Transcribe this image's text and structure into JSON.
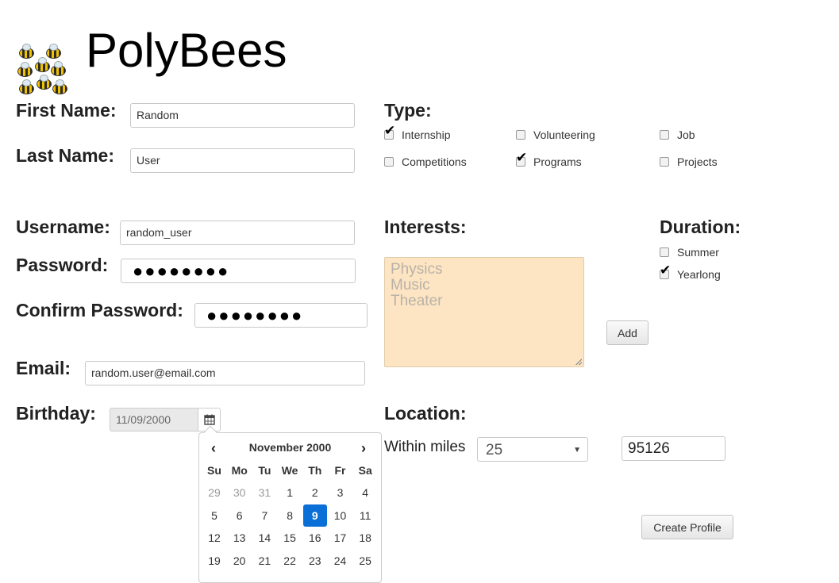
{
  "app": {
    "title": "PolyBees"
  },
  "form": {
    "first_name": {
      "label": "First Name:",
      "value": "Random"
    },
    "last_name": {
      "label": "Last Name:",
      "value": "User"
    },
    "username": {
      "label": "Username:",
      "value": "random_user"
    },
    "password": {
      "label": "Password:",
      "value": "●●●●●●●●"
    },
    "confirm_password": {
      "label": "Confirm Password:",
      "value": "●●●●●●●●"
    },
    "email": {
      "label": "Email:",
      "value": "random.user@email.com"
    },
    "birthday": {
      "label": "Birthday:",
      "value": "11/09/2000"
    }
  },
  "type": {
    "label": "Type:",
    "options": [
      {
        "label": "Internship",
        "checked": true
      },
      {
        "label": "Volunteering",
        "checked": false
      },
      {
        "label": "Job",
        "checked": false
      },
      {
        "label": "Competitions",
        "checked": false
      },
      {
        "label": "Programs",
        "checked": true
      },
      {
        "label": "Projects",
        "checked": false
      }
    ]
  },
  "interests": {
    "label": "Interests:",
    "placeholder_lines": [
      "Physics",
      "Music",
      "Theater"
    ],
    "add_label": "Add"
  },
  "duration": {
    "label": "Duration:",
    "options": [
      {
        "label": "Summer",
        "checked": false
      },
      {
        "label": "Yearlong",
        "checked": true
      }
    ]
  },
  "location": {
    "label": "Location:",
    "within_label": "Within miles",
    "miles_value": "25",
    "zip_value": "95126"
  },
  "create_label": "Create Profile",
  "calendar": {
    "month_label": "November 2000",
    "prev": "‹",
    "next": "›",
    "weekdays": [
      "Su",
      "Mo",
      "Tu",
      "We",
      "Th",
      "Fr",
      "Sa"
    ],
    "weeks": [
      [
        {
          "d": "29",
          "old": true
        },
        {
          "d": "30",
          "old": true
        },
        {
          "d": "31",
          "old": true
        },
        {
          "d": "1"
        },
        {
          "d": "2"
        },
        {
          "d": "3"
        },
        {
          "d": "4"
        }
      ],
      [
        {
          "d": "5"
        },
        {
          "d": "6"
        },
        {
          "d": "7"
        },
        {
          "d": "8"
        },
        {
          "d": "9",
          "active": true
        },
        {
          "d": "10"
        },
        {
          "d": "11"
        }
      ],
      [
        {
          "d": "12"
        },
        {
          "d": "13"
        },
        {
          "d": "14"
        },
        {
          "d": "15"
        },
        {
          "d": "16"
        },
        {
          "d": "17"
        },
        {
          "d": "18"
        }
      ],
      [
        {
          "d": "19"
        },
        {
          "d": "20"
        },
        {
          "d": "21"
        },
        {
          "d": "22"
        },
        {
          "d": "23"
        },
        {
          "d": "24"
        },
        {
          "d": "25"
        }
      ]
    ]
  }
}
